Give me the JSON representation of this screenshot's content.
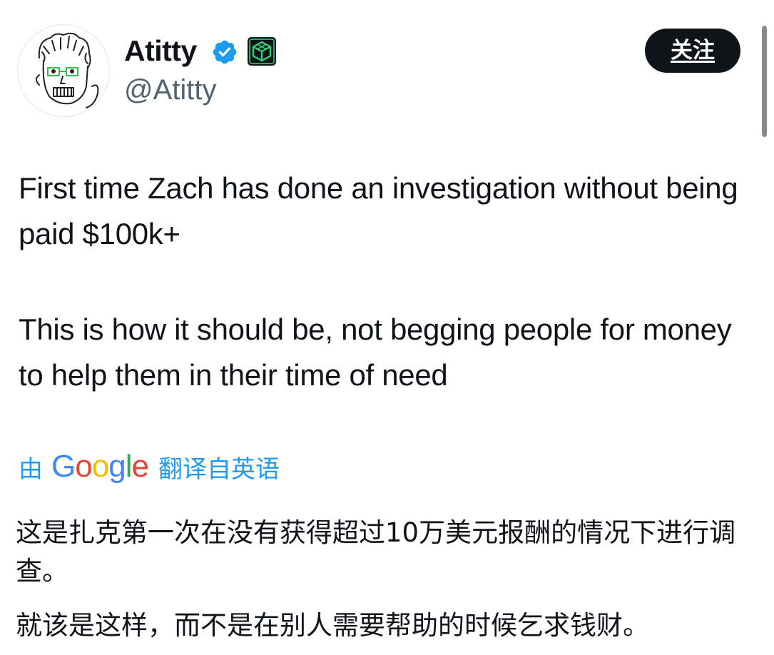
{
  "author": {
    "display_name": "Atitty",
    "handle": "@Atitty",
    "verified": true,
    "avatar_icon": "cartoon-portrait-avatar",
    "badge_icon": "affiliate-cube-badge"
  },
  "follow_label": "关注",
  "tweet": {
    "paragraphs": [
      "First time Zach has done an investigation without being paid $100k+",
      "This is how it should be, not begging people for money to help them in their time of need"
    ]
  },
  "translation": {
    "prefix": "由",
    "service": "Google",
    "suffix": "翻译自英语",
    "paragraphs": [
      "这是扎克第一次在没有获得超过10万美元报酬的情况下进行调查。",
      "就该是这样，而不是在别人需要帮助的时候乞求钱财。"
    ]
  },
  "colors": {
    "accent": "#1d9bf0",
    "text": "#0f1419",
    "secondary_text": "#536471",
    "verified": "#1d9bf0",
    "badge_green": "#33d17a",
    "google_blue": "#4285f4",
    "google_red": "#ea4335",
    "google_yellow": "#fbbc05",
    "google_green": "#34a853"
  }
}
